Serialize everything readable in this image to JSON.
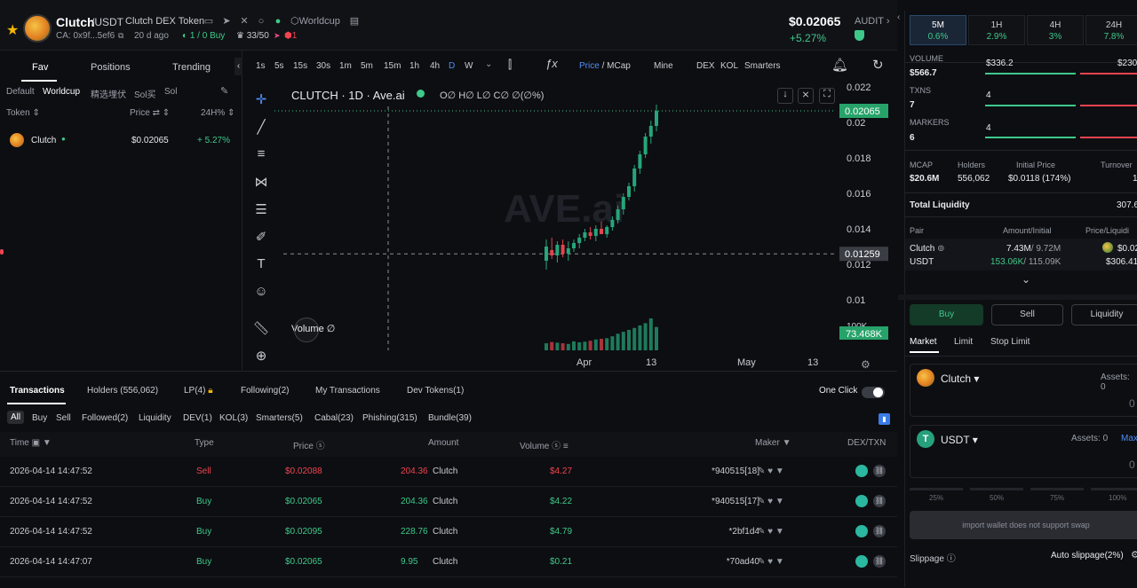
{
  "header": {
    "token_symbol": "Clutch",
    "pair_suffix": "/USDT",
    "full_name": "Clutch DEX Token",
    "ca": "CA: 0x9f...5ef6",
    "age": "20 d ago",
    "buy_count": "1 / 0 Buy",
    "holders_score": "33/50",
    "risk_count": "1",
    "tag": "Worldcup",
    "price": "$0.02065",
    "change": "+5.27%",
    "audit_label": "AUDIT"
  },
  "left_panel": {
    "tabs": [
      "Fav",
      "Positions",
      "Trending"
    ],
    "subtabs": [
      "Default",
      "Worldcup",
      "精选埋伏",
      "Sol买",
      "Sol"
    ],
    "col_token": "Token",
    "col_price": "Price",
    "col_24h": "24H%",
    "rows": [
      {
        "name": "Clutch",
        "price": "$0.02065",
        "change": "+ 5.27%"
      }
    ]
  },
  "chart_toolbar": {
    "timeframes": [
      "1s",
      "5s",
      "15s",
      "30s",
      "1m",
      "5m",
      "15m",
      "1h",
      "4h",
      "D",
      "W"
    ],
    "active_tf": "D",
    "price_label": "Price",
    "mcap_label": "MCap",
    "items": [
      "Mine",
      "DEX",
      "KOL",
      "Smarters"
    ]
  },
  "chart_data": {
    "type": "candlestick",
    "title": "CLUTCH · 1D · Ave.ai",
    "ohlc_legend": "O∅ H∅ L∅ C∅ ∅(∅%)",
    "watermark": "AVE.ai",
    "y_ticks": [
      "0.022",
      "0.02",
      "0.018",
      "0.016",
      "0.014",
      "0.012",
      "0.01"
    ],
    "ylim": [
      0.0099,
      0.0222
    ],
    "x_ticks": [
      "Apr",
      "13",
      "May",
      "13"
    ],
    "current_price_label": "0.02065",
    "current_price": 0.02065,
    "crosshair_label": "0.01259",
    "crosshair_price": 0.01259,
    "volume_label": "Volume",
    "volume_value_label": "73.468K",
    "volume_axis_tick": "100K",
    "candles": [
      {
        "o": 0.0122,
        "h": 0.0134,
        "l": 0.0117,
        "c": 0.013,
        "v": 22
      },
      {
        "o": 0.0128,
        "h": 0.0135,
        "l": 0.0123,
        "c": 0.0125,
        "v": 26
      },
      {
        "o": 0.0125,
        "h": 0.0133,
        "l": 0.0121,
        "c": 0.0131,
        "v": 24
      },
      {
        "o": 0.0131,
        "h": 0.0134,
        "l": 0.0124,
        "c": 0.0126,
        "v": 22
      },
      {
        "o": 0.0126,
        "h": 0.0133,
        "l": 0.0122,
        "c": 0.0129,
        "v": 20
      },
      {
        "o": 0.0129,
        "h": 0.0134,
        "l": 0.0127,
        "c": 0.0132,
        "v": 28
      },
      {
        "o": 0.0132,
        "h": 0.0137,
        "l": 0.0129,
        "c": 0.0135,
        "v": 25
      },
      {
        "o": 0.0135,
        "h": 0.014,
        "l": 0.0133,
        "c": 0.0138,
        "v": 27
      },
      {
        "o": 0.0138,
        "h": 0.0141,
        "l": 0.0134,
        "c": 0.0136,
        "v": 30
      },
      {
        "o": 0.0136,
        "h": 0.0142,
        "l": 0.0133,
        "c": 0.014,
        "v": 34
      },
      {
        "o": 0.014,
        "h": 0.0144,
        "l": 0.0137,
        "c": 0.0137,
        "v": 36
      },
      {
        "o": 0.0137,
        "h": 0.0142,
        "l": 0.0135,
        "c": 0.0141,
        "v": 38
      },
      {
        "o": 0.0141,
        "h": 0.0147,
        "l": 0.0139,
        "c": 0.0145,
        "v": 44
      },
      {
        "o": 0.0145,
        "h": 0.0153,
        "l": 0.0143,
        "c": 0.0151,
        "v": 52
      },
      {
        "o": 0.0151,
        "h": 0.016,
        "l": 0.0148,
        "c": 0.0158,
        "v": 58
      },
      {
        "o": 0.0158,
        "h": 0.0166,
        "l": 0.0156,
        "c": 0.0164,
        "v": 64
      },
      {
        "o": 0.0164,
        "h": 0.0176,
        "l": 0.0161,
        "c": 0.0174,
        "v": 70
      },
      {
        "o": 0.0174,
        "h": 0.0184,
        "l": 0.0171,
        "c": 0.0182,
        "v": 78
      },
      {
        "o": 0.0182,
        "h": 0.0194,
        "l": 0.018,
        "c": 0.0192,
        "v": 85
      },
      {
        "o": 0.0192,
        "h": 0.0201,
        "l": 0.0188,
        "c": 0.0198,
        "v": 100
      },
      {
        "o": 0.0198,
        "h": 0.021,
        "l": 0.0195,
        "c": 0.02065,
        "v": 73
      }
    ]
  },
  "bottom": {
    "tabs": [
      "Transactions",
      "Holders (556,062)",
      "LP(4)",
      "Following(2)",
      "My Transactions",
      "Dev Tokens(1)"
    ],
    "one_click": "One Click",
    "filters": [
      "All",
      "Buy",
      "Sell",
      "Followed(2)",
      "Liquidity",
      "DEV(1)",
      "KOL(3)",
      "Smarters(5)",
      "Cabal(23)",
      "Phishing(315)",
      "Bundle(39)"
    ],
    "columns": [
      "Time",
      "Type",
      "Price",
      "Amount",
      "Volume",
      "Maker",
      "DEX/TXN"
    ],
    "rows": [
      {
        "time": "2026-04-14 14:47:52",
        "type": "Sell",
        "price": "$0.02088",
        "amount": "204.36",
        "unit": "Clutch",
        "volume": "$4.27",
        "maker": "*940515[18]"
      },
      {
        "time": "2026-04-14 14:47:52",
        "type": "Buy",
        "price": "$0.02065",
        "amount": "204.36",
        "unit": "Clutch",
        "volume": "$4.22",
        "maker": "*940515[17]"
      },
      {
        "time": "2026-04-14 14:47:52",
        "type": "Buy",
        "price": "$0.02095",
        "amount": "228.76",
        "unit": "Clutch",
        "volume": "$4.79",
        "maker": "*2bf1d4"
      },
      {
        "time": "2026-04-14 14:47:07",
        "type": "Buy",
        "price": "$0.02065",
        "amount": "9.95",
        "unit": "Clutch",
        "volume": "$0.21",
        "maker": "*70ad40"
      }
    ]
  },
  "right_panel": {
    "timeframes": [
      {
        "label": "5M",
        "change": "0.6%"
      },
      {
        "label": "1H",
        "change": "2.9%"
      },
      {
        "label": "4H",
        "change": "3%"
      },
      {
        "label": "24H",
        "change": "7.8%"
      }
    ],
    "volume_label": "VOLUME",
    "volume_value": "$566.7",
    "volume_buy": "$336.2",
    "volume_sell": "$230",
    "txns_label": "TXNS",
    "txns_value": "7",
    "txns_buy": "4",
    "makers_label": "MARKERS",
    "makers_value": "6",
    "makers_buy": "4",
    "mcap_label": "MCAP",
    "mcap_value": "$20.6M",
    "holders_label": "Holders",
    "holders_value": "556,062",
    "init_label": "Initial Price",
    "init_value": "$0.0118 (174%)",
    "turnover_label": "Turnover",
    "turnover_value": "1",
    "liq_label": "Total Liquidity",
    "liq_value": "307.6",
    "pair_label": "Pair",
    "amt_label": "Amount/Initial",
    "pl_label": "Price/Liquidi",
    "pair1": "Clutch",
    "pair1_amt": "7.43M",
    "pair1_init": "/ 9.72M",
    "pair1_price": "$0.02",
    "pair2": "USDT",
    "pair2_amt": "153.06K",
    "pair2_init": "/ 115.09K",
    "pair2_liq": "$306.41",
    "buy_btn": "Buy",
    "sell_btn": "Sell",
    "liquidity_btn": "Liquidity",
    "order_tabs": [
      "Market",
      "Limit",
      "Stop Limit"
    ],
    "from_token": "Clutch",
    "assets_label": "Assets:",
    "assets_from": "0",
    "to_token": "USDT",
    "assets_to": "Assets: 0",
    "max": "Max",
    "amount_placeholder": "0",
    "pcts": [
      "25%",
      "50%",
      "75%",
      "100%"
    ],
    "swap_disabled": "import wallet does not support swap",
    "slippage_label": "Slippage",
    "auto_slippage": "Auto slippage(2%)"
  }
}
